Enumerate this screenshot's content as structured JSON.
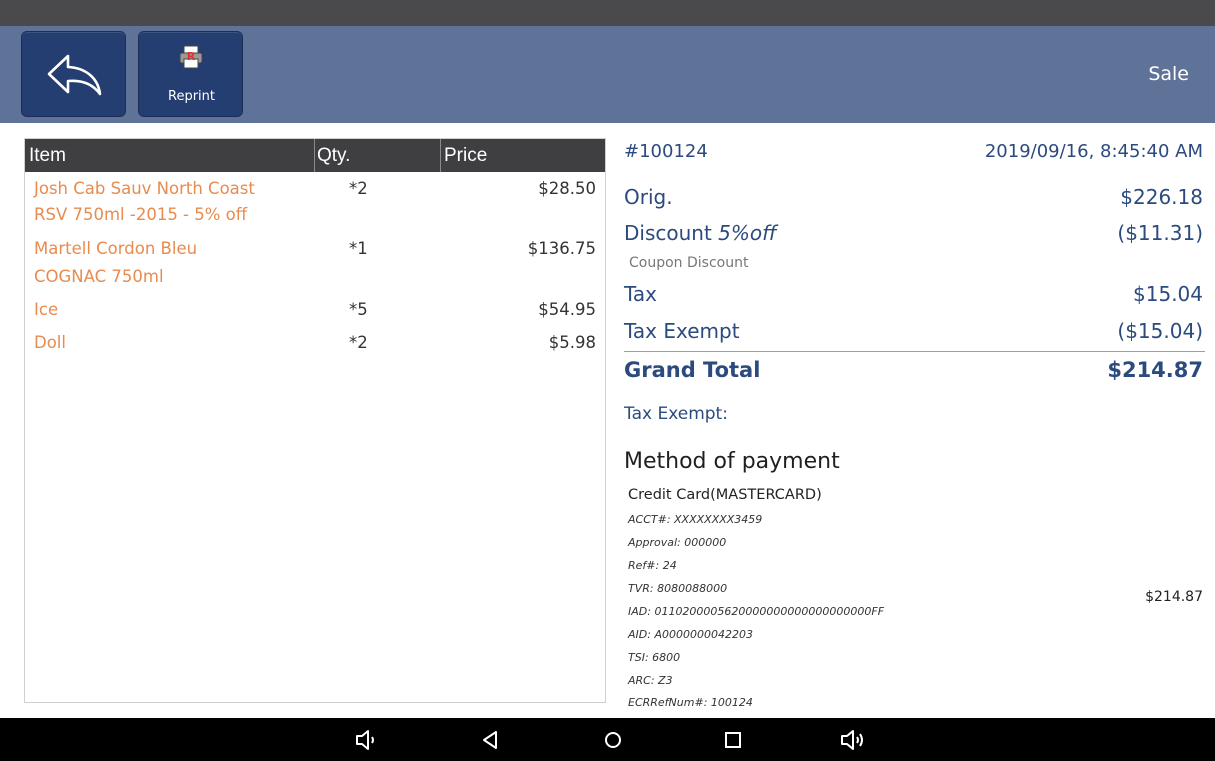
{
  "header": {
    "back_icon": "back-arrow-icon",
    "reprint_label": "Reprint",
    "reprint_icon": "printer-icon",
    "title": "Sale",
    "colors": {
      "header_bg": "#5f7399",
      "button_bg": "#243e71"
    }
  },
  "items": {
    "columns": [
      "Item",
      "Qty.",
      "Price"
    ],
    "rows": [
      {
        "name_line1": "Josh Cab Sauv North Coast",
        "name_line2": "RSV 750ml -2015 - 5% off",
        "qty": "*2",
        "price": "$28.50"
      },
      {
        "name_line1": "Martell Cordon Bleu",
        "name_line2": "COGNAC 750ml",
        "qty": "*1",
        "price": "$136.75"
      },
      {
        "name_line1": "Ice",
        "name_line2": "",
        "qty": "*5",
        "price": "$54.95"
      },
      {
        "name_line1": "Doll",
        "name_line2": "",
        "qty": "*2",
        "price": "$5.98"
      }
    ],
    "colors": {
      "item_name": "#e88b4e"
    }
  },
  "summary": {
    "order_number": "#100124",
    "datetime": "2019/09/16, 8:45:40 AM",
    "orig_label": "Orig.",
    "orig_value": "$226.18",
    "discount_label": "Discount",
    "discount_note": "5%off",
    "discount_value": "($11.31)",
    "coupon_label": "Coupon Discount",
    "tax_label": "Tax",
    "tax_value": "$15.04",
    "tax_exempt_label": "Tax Exempt",
    "tax_exempt_value": "($15.04)",
    "grand_total_label": "Grand Total",
    "grand_total_value": "$214.87",
    "tax_exempt_info": "Tax Exempt:",
    "colors": {
      "summary_text": "#2b4a7e"
    }
  },
  "payment": {
    "title": "Method of payment",
    "card": "Credit Card(MASTERCARD)",
    "amount": "$214.87",
    "details": [
      "ACCT#: XXXXXXXX3459",
      "Approval: 000000",
      "Ref#: 24",
      "TVR: 8080088000",
      "IAD: 0110200005620000000000000000000FF",
      "AID: A0000000042203",
      "TSI: 6800",
      "ARC: Z3",
      "ECRRefNum#: 100124"
    ]
  },
  "navbar": {
    "icons": [
      "volume-down-icon",
      "back-triangle-icon",
      "home-circle-icon",
      "recents-square-icon",
      "volume-up-icon"
    ]
  }
}
